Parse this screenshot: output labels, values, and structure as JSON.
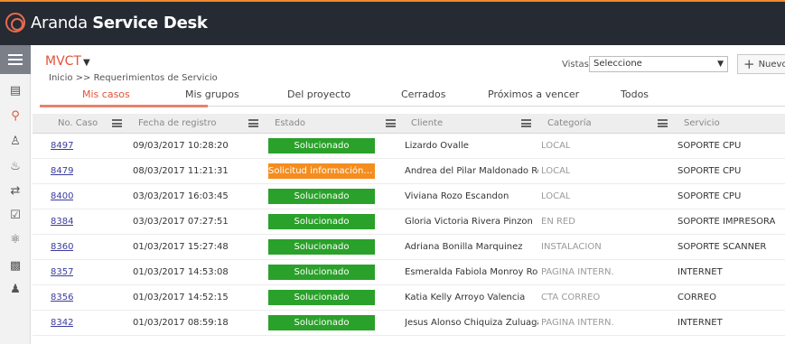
{
  "app": {
    "title_light": "Aranda",
    "title_bold": "Service Desk"
  },
  "header": {
    "project": "MVCT",
    "breadcrumb": "Inicio >> Requerimientos de Servicio"
  },
  "vistas": {
    "label": "Vistas:",
    "selected": "Seleccione"
  },
  "toolbar": {
    "new_label": "Nuevo"
  },
  "tabs": [
    {
      "label": "Mis casos",
      "active": true
    },
    {
      "label": "Mis grupos"
    },
    {
      "label": "Del proyecto"
    },
    {
      "label": "Cerrados"
    },
    {
      "label": "Próximos a vencer"
    },
    {
      "label": "Todos"
    }
  ],
  "columns": [
    "No. Caso",
    "Fecha de registro",
    "Estado",
    "Cliente",
    "Categoría",
    "Servicio"
  ],
  "rows": [
    {
      "id": "8497",
      "date": "09/03/2017 10:28:20",
      "status": "Solucionado",
      "status_color": "#2aa12a",
      "client": "Lizardo Ovalle",
      "category": "LOCAL",
      "service": "SOPORTE CPU"
    },
    {
      "id": "8479",
      "date": "08/03/2017 11:21:31",
      "status": "Solicitud información adicional",
      "status_color": "#f58d1e",
      "client": "Andrea del Pilar Maldonado Romero",
      "category": "LOCAL",
      "service": "SOPORTE CPU"
    },
    {
      "id": "8400",
      "date": "03/03/2017 16:03:45",
      "status": "Solucionado",
      "status_color": "#2aa12a",
      "client": "Viviana Rozo Escandon",
      "category": "LOCAL",
      "service": "SOPORTE CPU"
    },
    {
      "id": "8384",
      "date": "03/03/2017 07:27:51",
      "status": "Solucionado",
      "status_color": "#2aa12a",
      "client": "Gloria Victoria Rivera Pinzon",
      "category": "EN RED",
      "service": "SOPORTE IMPRESORA"
    },
    {
      "id": "8360",
      "date": "01/03/2017 15:27:48",
      "status": "Solucionado",
      "status_color": "#2aa12a",
      "client": "Adriana Bonilla Marquinez",
      "category": "INSTALACIÓN",
      "service": "SOPORTE SCANNER"
    },
    {
      "id": "8357",
      "date": "01/03/2017 14:53:08",
      "status": "Solucionado",
      "status_color": "#2aa12a",
      "client": "Esmeralda Fabiola Monroy Rodriguez",
      "category": "PAGINA INTERN.",
      "service": "INTERNET"
    },
    {
      "id": "8356",
      "date": "01/03/2017 14:52:15",
      "status": "Solucionado",
      "status_color": "#2aa12a",
      "client": "Katia Kelly Arroyo Valencia",
      "category": "CTA CORREO",
      "service": "CORREO"
    },
    {
      "id": "8342",
      "date": "01/03/2017 08:59:18",
      "status": "Solucionado",
      "status_color": "#2aa12a",
      "client": "Jesus Alonso Chiquiza Zuluaga",
      "category": "PAGINA INTERN.",
      "service": "INTERNET"
    }
  ],
  "sidebar": {
    "icons": [
      "menu-icon",
      "document-icon",
      "headset-icon",
      "user-icon",
      "fire-icon",
      "change-icon",
      "checklist-icon",
      "alarm-icon",
      "box-icon",
      "users-icon"
    ]
  },
  "colors": {
    "accent": "#e2543a",
    "topbar": "#252a33",
    "success": "#2aa12a",
    "warning": "#f58d1e"
  }
}
